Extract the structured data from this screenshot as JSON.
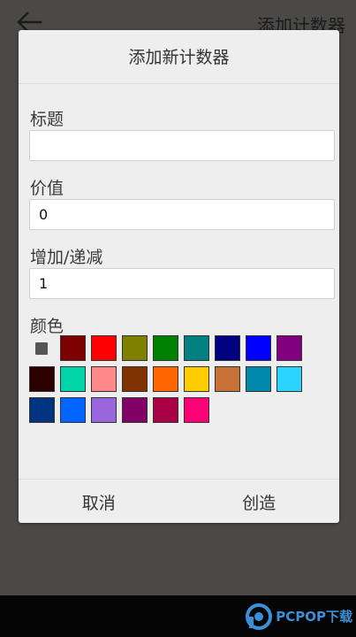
{
  "app": {
    "title": "添加计数器",
    "back_icon": "back-arrow-icon"
  },
  "dialog": {
    "title": "添加新计数器",
    "fields": {
      "title": {
        "label": "标题",
        "value": "",
        "placeholder": ""
      },
      "value": {
        "label": "价值",
        "value": "0"
      },
      "step": {
        "label": "增加/递减",
        "value": "1"
      }
    },
    "color_label": "颜色",
    "colors": [
      "#555555",
      "#7f0000",
      "#ff0000",
      "#808000",
      "#008000",
      "#008080",
      "#000080",
      "#0000ff",
      "#800080",
      "#2d0000",
      "#00d4a8",
      "#ff8888",
      "#803300",
      "#ff6600",
      "#ffcc00",
      "#c87137",
      "#0088aa",
      "#2ad4ff",
      "#003380",
      "#0066ff",
      "#9966dd",
      "#800066",
      "#aa0044",
      "#ff0077"
    ],
    "selected_color_index": 0,
    "cancel_label": "取消",
    "create_label": "创造"
  },
  "watermark": {
    "text": "PCPOP下载"
  }
}
